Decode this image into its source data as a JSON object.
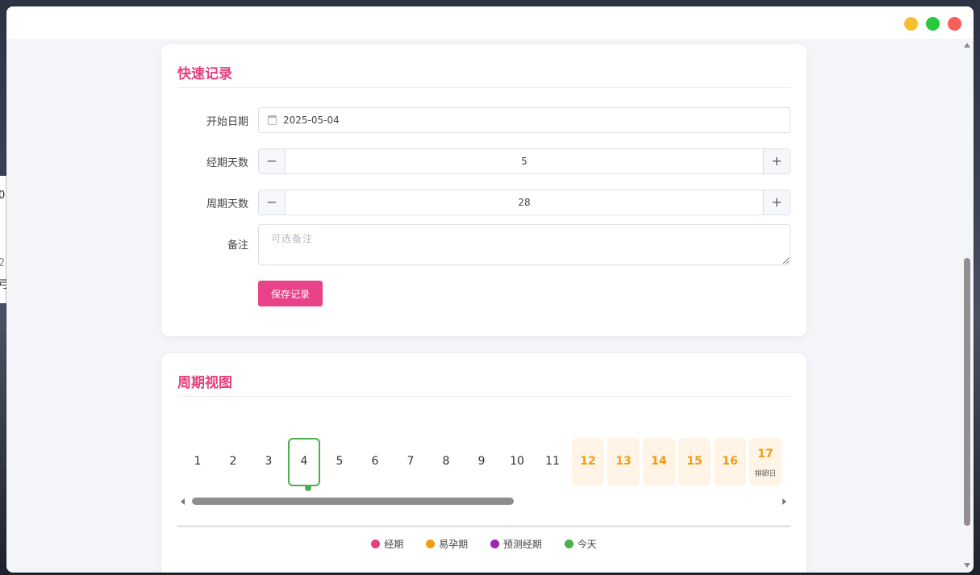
{
  "background_window": {
    "fragments": [
      "0",
      "2",
      "弓"
    ]
  },
  "colors": {
    "accent": "#e5407f",
    "period": "#e5407f",
    "fertile": "#f39c12",
    "predicted": "#9c27b0",
    "today": "#4caf50"
  },
  "quick_record": {
    "title": "快速记录",
    "start_date_label": "开始日期",
    "start_date_value": "2025-05-04",
    "period_days_label": "经期天数",
    "period_days_value": "5",
    "cycle_days_label": "周期天数",
    "cycle_days_value": "28",
    "stepper_minus": "−",
    "stepper_plus": "+",
    "note_label": "备注",
    "note_placeholder": "可选备注",
    "save_label": "保存记录"
  },
  "cycle_view": {
    "title": "周期视图",
    "days": [
      {
        "num": "1"
      },
      {
        "num": "2"
      },
      {
        "num": "3"
      },
      {
        "num": "4",
        "today": true
      },
      {
        "num": "5"
      },
      {
        "num": "6"
      },
      {
        "num": "7"
      },
      {
        "num": "8"
      },
      {
        "num": "9"
      },
      {
        "num": "10"
      },
      {
        "num": "11"
      },
      {
        "num": "12",
        "fertile": true
      },
      {
        "num": "13",
        "fertile": true
      },
      {
        "num": "14",
        "fertile": true
      },
      {
        "num": "15",
        "fertile": true
      },
      {
        "num": "16",
        "fertile": true
      },
      {
        "num": "17",
        "fertile": true,
        "sub": "排卵日"
      }
    ],
    "legend": {
      "period": "经期",
      "fertile": "易孕期",
      "predicted": "预测经期",
      "today": "今天"
    }
  }
}
